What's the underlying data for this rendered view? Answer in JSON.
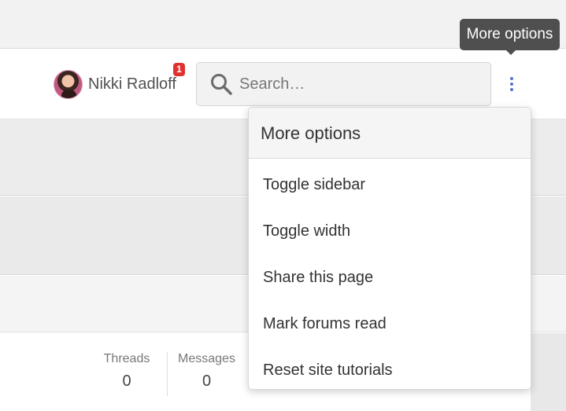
{
  "user": {
    "name": "Nikki Radloff",
    "alerts_count": "1"
  },
  "search": {
    "placeholder": "Search…",
    "icon": "search-icon"
  },
  "tooltip": {
    "text": "More options"
  },
  "more_menu": {
    "title": "More options",
    "items": [
      {
        "label": "Toggle sidebar"
      },
      {
        "label": "Toggle width"
      },
      {
        "label": "Share this page"
      },
      {
        "label": "Mark forums read"
      },
      {
        "label": "Reset site tutorials"
      }
    ]
  },
  "stats": {
    "threads_label": "Threads",
    "threads_value": "0",
    "messages_label": "Messages",
    "messages_value": "0"
  },
  "colors": {
    "accent": "#5b6fcf",
    "badge": "#e03131",
    "tooltip_bg": "#4f4f4f"
  }
}
